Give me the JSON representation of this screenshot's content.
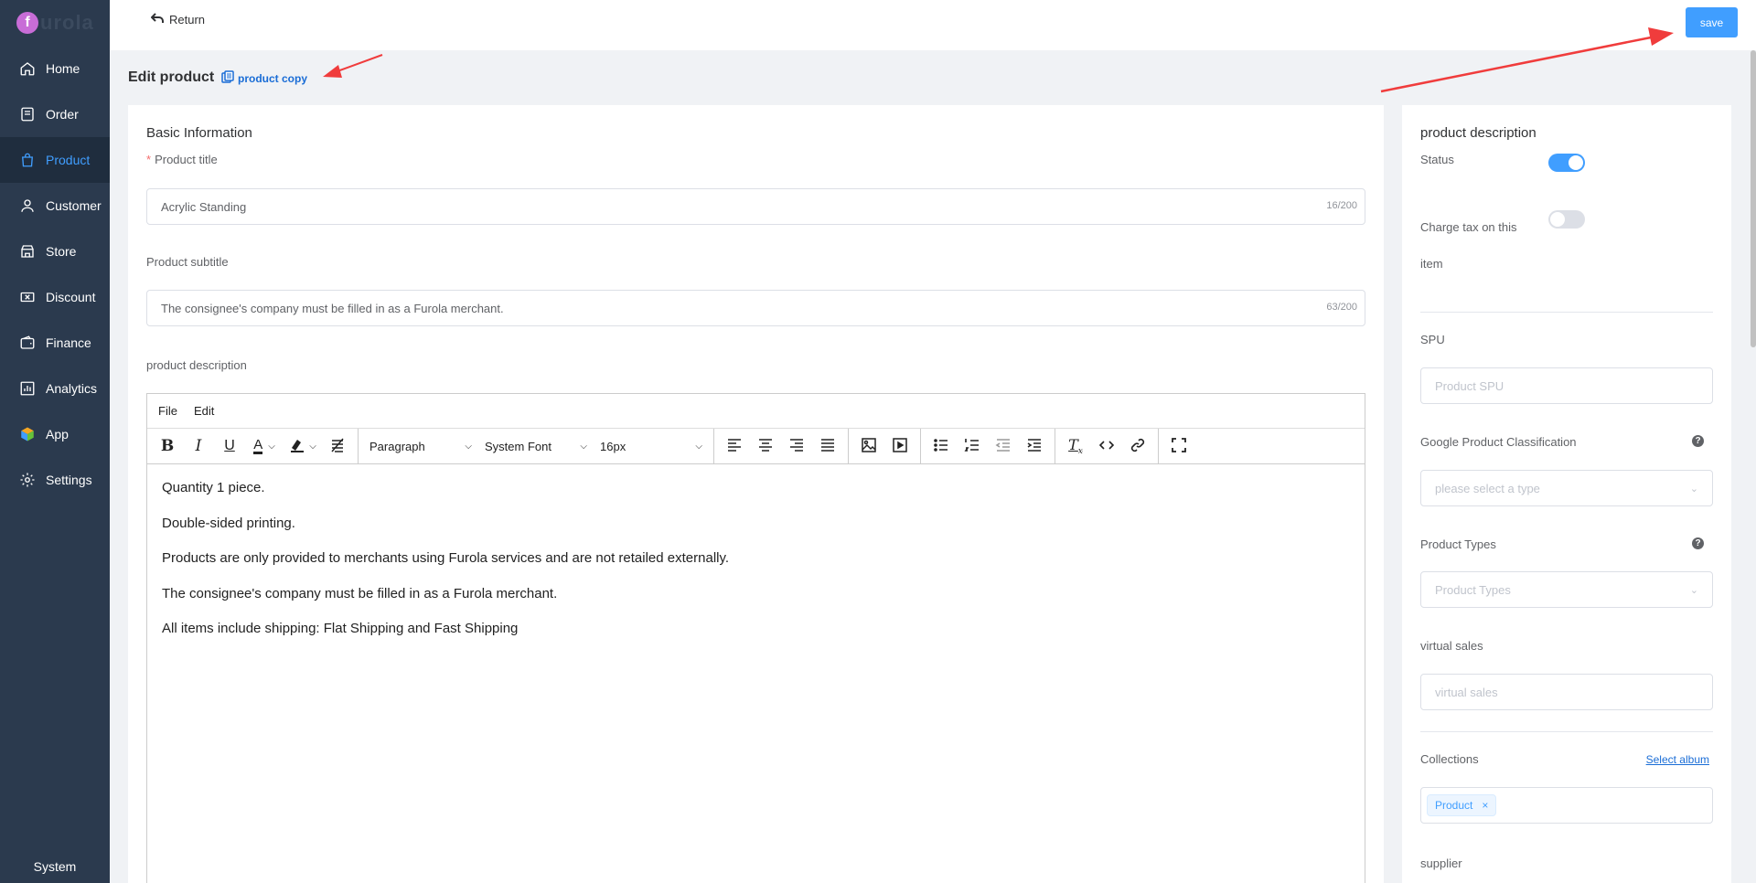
{
  "brand": {
    "logo_letter": "f",
    "logo_text": "urola"
  },
  "sidebar": {
    "items": [
      {
        "label": "Home",
        "icon": "home-icon"
      },
      {
        "label": "Order",
        "icon": "order-icon"
      },
      {
        "label": "Product",
        "icon": "bag-icon",
        "active": true
      },
      {
        "label": "Customer",
        "icon": "user-icon"
      },
      {
        "label": "Store",
        "icon": "store-icon"
      },
      {
        "label": "Discount",
        "icon": "ticket-icon"
      },
      {
        "label": "Finance",
        "icon": "wallet-icon"
      },
      {
        "label": "Analytics",
        "icon": "chart-icon"
      },
      {
        "label": "App",
        "icon": "cube-icon"
      },
      {
        "label": "Settings",
        "icon": "gear-icon"
      }
    ],
    "bottom": "System"
  },
  "topbar": {
    "return_label": "Return",
    "save_label": "save"
  },
  "page": {
    "title": "Edit product",
    "copy_label": "product copy"
  },
  "basic": {
    "section_title": "Basic Information",
    "title_label": "Product title",
    "title_value": "Acrylic Standing",
    "title_count": "16/200",
    "subtitle_label": "Product subtitle",
    "subtitle_value": "The consignee's company must be filled in as a Furola merchant.",
    "subtitle_count": "63/200",
    "description_label": "product description"
  },
  "editor": {
    "menu": [
      "File",
      "Edit"
    ],
    "block_format": "Paragraph",
    "font_family": "System Font",
    "font_size": "16px",
    "content": [
      "Quantity 1 piece.",
      "Double-sided printing.",
      "Products are only provided to merchants using Furola services and are not retailed externally.",
      "The consignee's company must be filled in as a Furola merchant.",
      "All items include shipping: Flat Shipping and Fast Shipping"
    ]
  },
  "side": {
    "title": "product description",
    "status_label": "Status",
    "status_on": true,
    "tax_label_1": "Charge tax on this",
    "tax_label_2": "item",
    "tax_on": false,
    "spu_label": "SPU",
    "spu_placeholder": "Product SPU",
    "google_label": "Google Product Classification",
    "google_placeholder": "please select a type",
    "types_label": "Product Types",
    "types_placeholder": "Product Types",
    "virtual_label": "virtual sales",
    "virtual_placeholder": "virtual sales",
    "collections_label": "Collections",
    "select_album": "Select album",
    "collection_tag": "Product",
    "supplier_label": "supplier"
  },
  "colors": {
    "primary": "#409eff",
    "sidebar": "#2b3a4e",
    "annotation": "#f03c3c"
  }
}
